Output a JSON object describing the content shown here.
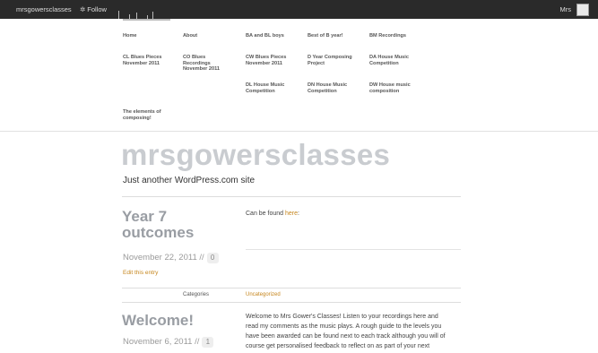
{
  "adminbar": {
    "site_name": "mrsgowersclasses",
    "follow_label": "Follow",
    "user_label": "Mrs"
  },
  "menu": {
    "items": [
      {
        "label": "Home"
      },
      {
        "label": "About"
      },
      {
        "label": "BA and BL boys"
      },
      {
        "label": "Best of B year!"
      },
      {
        "label": "BM Recordings"
      },
      {
        "label": "CL Blues Pieces November 2011"
      },
      {
        "label": "CO Blues Recordings November 2011"
      },
      {
        "label": "CW Blues Pieces November 2011"
      },
      {
        "label": "D Year Composing Project"
      },
      {
        "label": "DA House Music Competition"
      },
      {
        "label": "DL House Music Competition"
      },
      {
        "label": "DN House Music Competition"
      },
      {
        "label": "DW House music composition"
      },
      {
        "label": "The elements of composing!"
      }
    ]
  },
  "header": {
    "site_title": "mrsgowersclasses",
    "tagline": "Just another WordPress.com site"
  },
  "posts": [
    {
      "title": "Year 7 outcomes",
      "date": "November 22, 2011 //",
      "comments": "0",
      "edit_label": "Edit this entry",
      "body_prefix": "Can be found ",
      "body_link": "here",
      "body_suffix": ":",
      "categories_label": "Categories",
      "category": "Uncategorized"
    },
    {
      "title": "Welcome!",
      "date": "November 6, 2011 //",
      "comments": "1",
      "body_lines": [
        "Welcome to Mrs Gower's Classes! Listen to your recordings here and",
        "read my comments as the music plays. A rough guide to the levels you",
        "have been awarded can be found next to each track although you will of",
        "course get personalised feedback to reflect on as part of your next"
      ]
    }
  ]
}
